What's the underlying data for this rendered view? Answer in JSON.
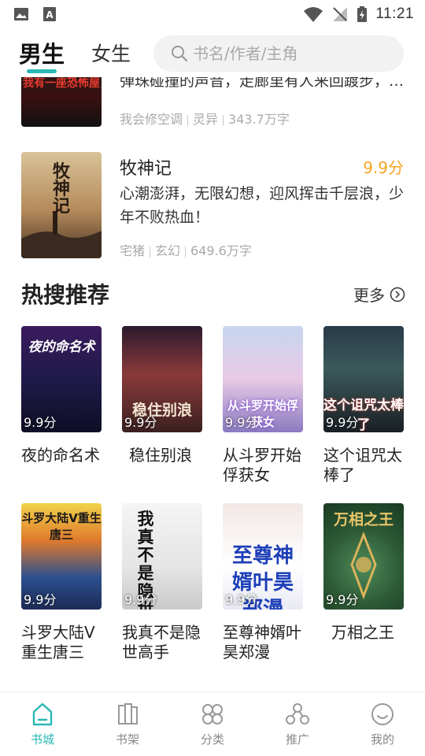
{
  "status_bar": {
    "time": "11:21"
  },
  "header": {
    "tabs": [
      {
        "label": "男生",
        "active": true
      },
      {
        "label": "女生",
        "active": false
      }
    ],
    "search_placeholder": "书名/作者/主角"
  },
  "featured_books": [
    {
      "title": "我有一座恐怖屋",
      "desc": "弹珠碰撞的声音，走廊里有人来回踱步，…",
      "author": "我会修空调",
      "genre": "灵异",
      "words": "343.7万字"
    },
    {
      "title": "牧神记",
      "score": "9.9分",
      "desc": "心潮澎湃，无限幻想，迎风挥击千层浪，少年不败热血！",
      "author": "宅猪",
      "genre": "玄幻",
      "words": "649.6万字"
    }
  ],
  "hot_section": {
    "title": "热搜推荐",
    "more": "更多",
    "books": [
      {
        "title": "夜的命名术",
        "score": "9.9分"
      },
      {
        "title": "稳住别浪",
        "score": "9.9分"
      },
      {
        "title": "从斗罗开始俘获女",
        "score": "9.9分"
      },
      {
        "title": "这个诅咒太棒了",
        "score": "9.9分"
      },
      {
        "title": "斗罗大陆V重生唐三",
        "score": "9.9分"
      },
      {
        "title": "我真不是隐世高手",
        "score": "9.9分"
      },
      {
        "title": "至尊神婿叶昊郑漫",
        "score": "9.9分"
      },
      {
        "title": "万相之王",
        "score": "9.9分"
      }
    ]
  },
  "bottom_nav": [
    {
      "label": "书城",
      "icon": "bookstore-icon",
      "active": true
    },
    {
      "label": "书架",
      "icon": "bookshelf-icon",
      "active": false
    },
    {
      "label": "分类",
      "icon": "category-icon",
      "active": false
    },
    {
      "label": "推广",
      "icon": "promote-icon",
      "active": false
    },
    {
      "label": "我的",
      "icon": "profile-icon",
      "active": false
    }
  ],
  "colors": {
    "accent": "#2ab8b5",
    "score": "#f5a623",
    "meta": "#aaaaaa"
  }
}
